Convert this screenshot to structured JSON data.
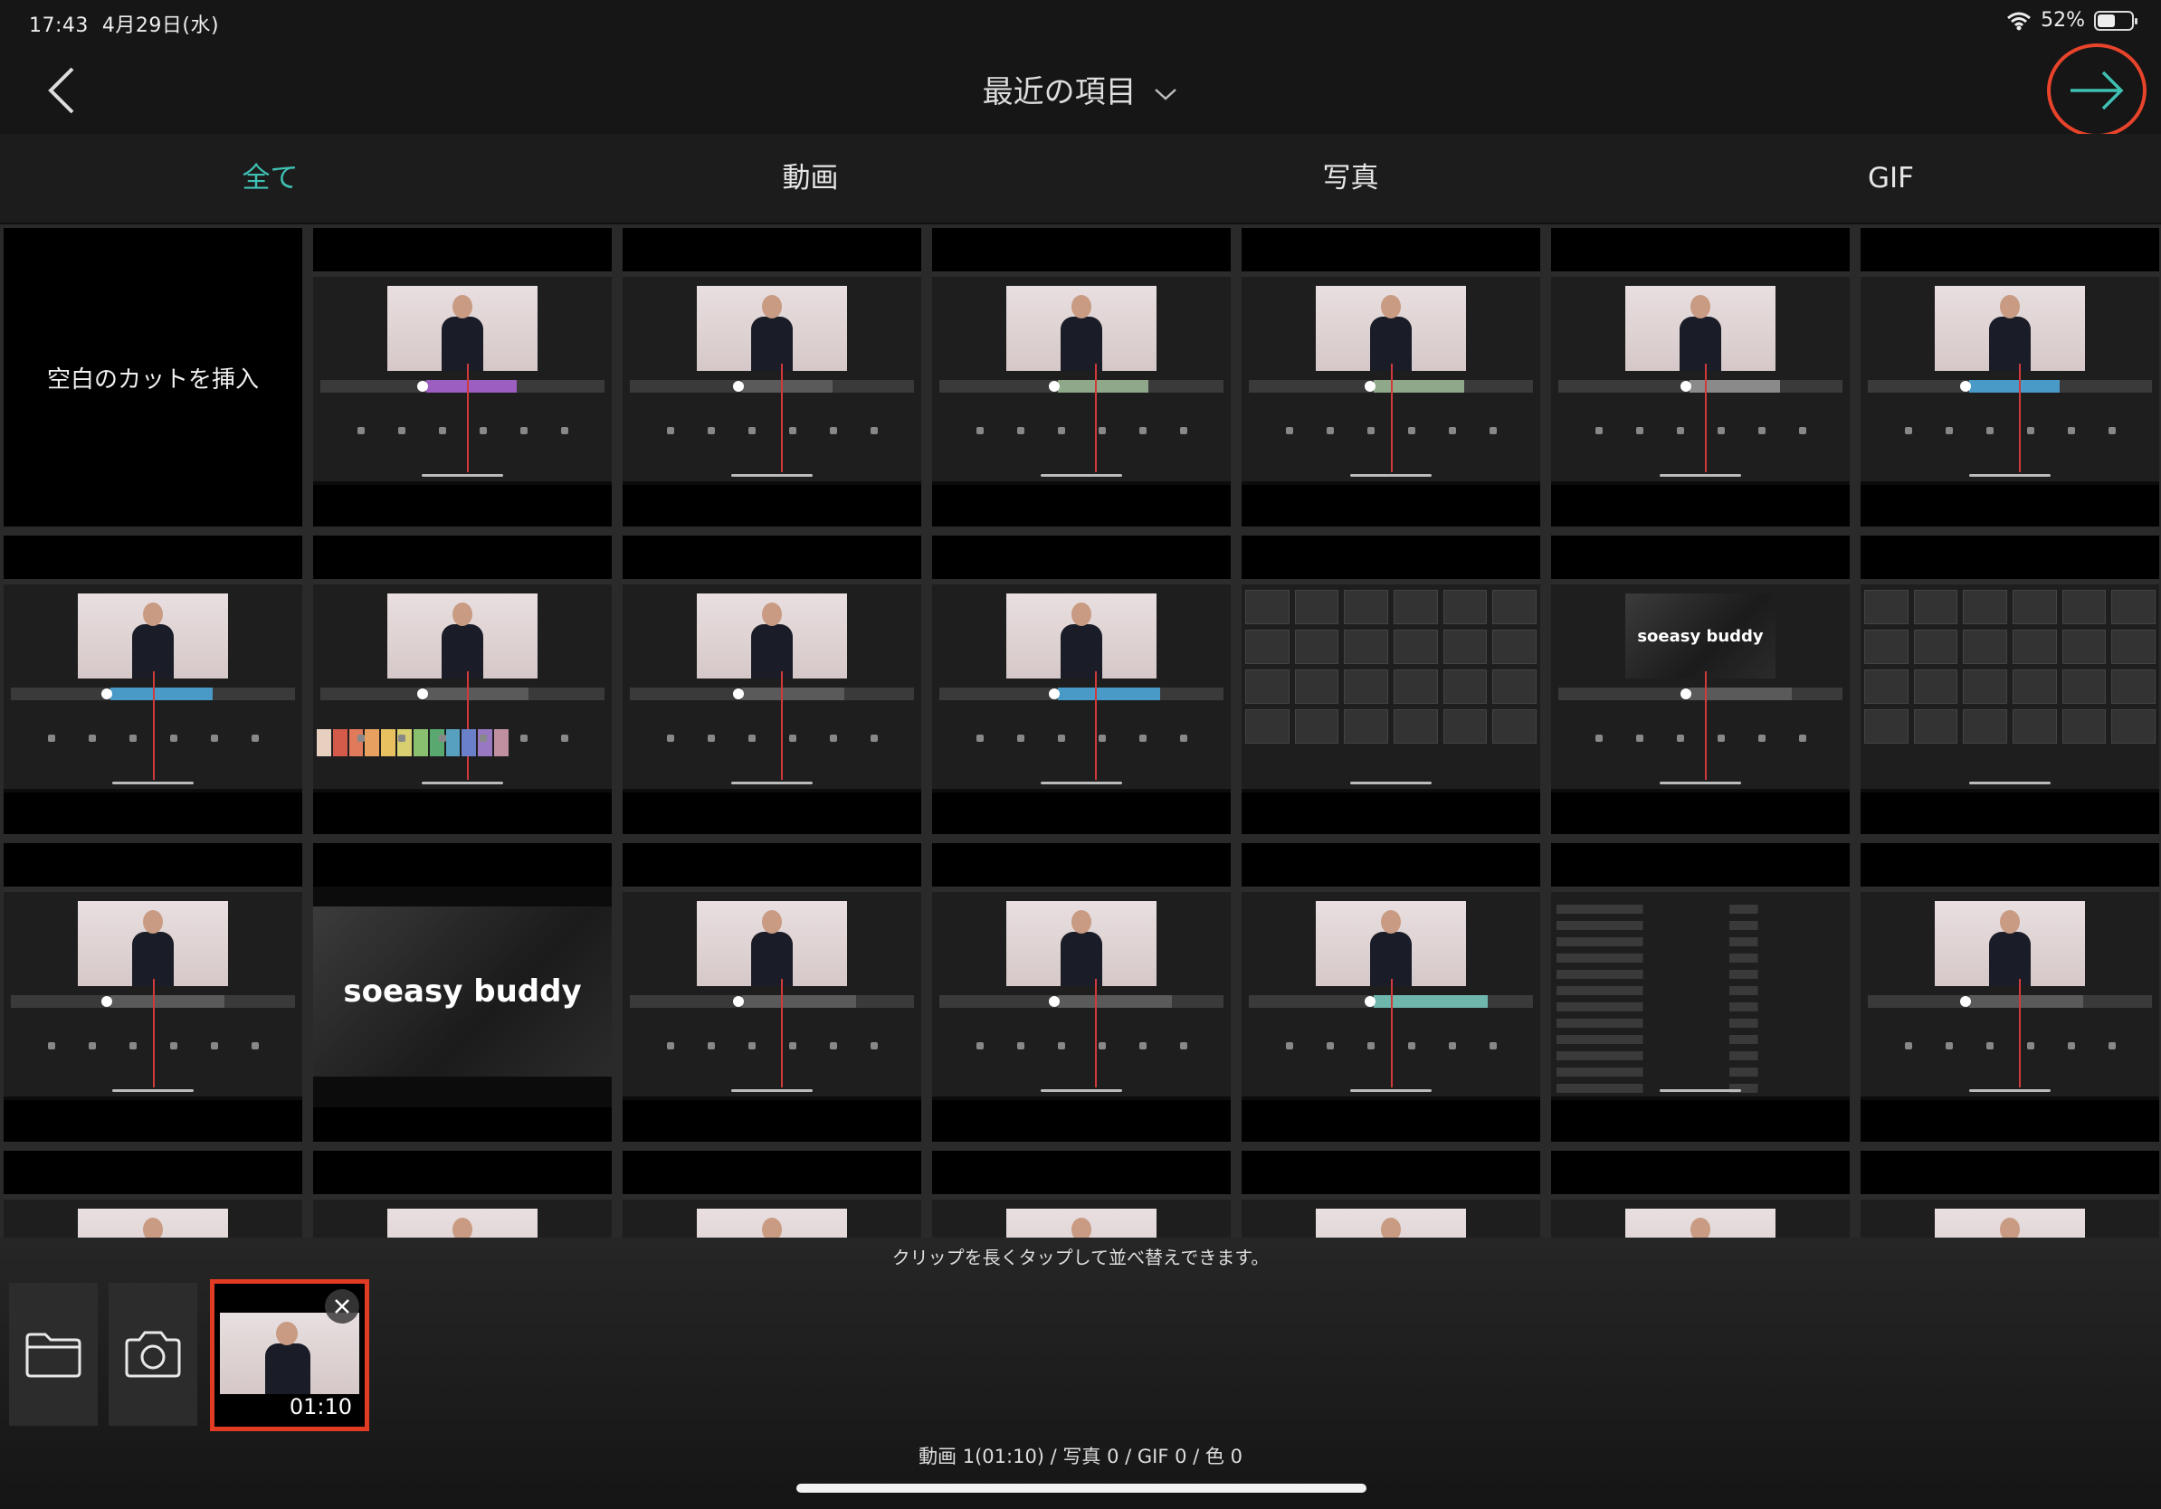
{
  "status": {
    "time": "17:43",
    "date": "4月29日(水)",
    "battery": "52%",
    "battery_level": 0.52
  },
  "nav": {
    "title": "最近の項目"
  },
  "tabs": [
    {
      "label": "全て",
      "active": true
    },
    {
      "label": "動画",
      "active": false
    },
    {
      "label": "写真",
      "active": false
    },
    {
      "label": "GIF",
      "active": false
    }
  ],
  "grid": {
    "blank_cut_label": "空白のカットを挿入",
    "brand_text": "soeasy buddy"
  },
  "tray": {
    "hint": "クリップを長くタップして並べ替えできます。",
    "selected_clip_duration": "01:10",
    "summary": "動画 1(01:10) / 写真 0 / GIF 0 / 色 0"
  },
  "colors": {
    "accent": "#3fc1b4",
    "highlight": "#e8432b"
  }
}
